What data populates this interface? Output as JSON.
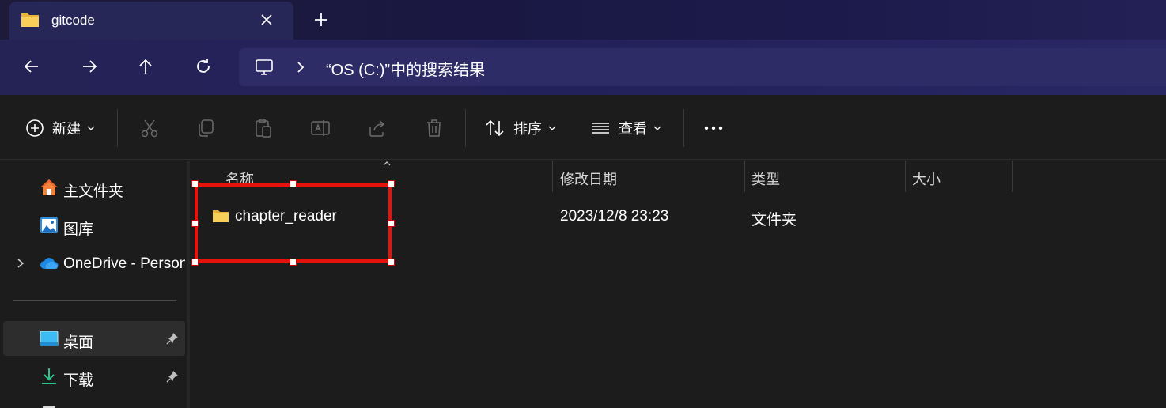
{
  "window": {
    "tab_title": "gitcode"
  },
  "address": {
    "text": "“OS (C:)”中的搜索结果"
  },
  "toolbar": {
    "new_label": "新建",
    "sort_label": "排序",
    "view_label": "查看"
  },
  "sidebar": {
    "items": [
      {
        "label": "主文件夹",
        "icon": "home-icon",
        "pinned": false,
        "selected": false
      },
      {
        "label": "图库",
        "icon": "gallery-icon",
        "pinned": false,
        "selected": false
      },
      {
        "label": "OneDrive - Personal",
        "icon": "onedrive-icon",
        "pinned": false,
        "selected": false,
        "expandable": true
      },
      {
        "label": "桌面",
        "icon": "desktop-icon",
        "pinned": true,
        "selected": true
      },
      {
        "label": "下载",
        "icon": "download-icon",
        "pinned": true,
        "selected": false
      }
    ]
  },
  "columns": {
    "name": "名称",
    "modified": "修改日期",
    "type": "类型",
    "size": "大小"
  },
  "rows": [
    {
      "name": "chapter_reader",
      "modified": "2023/12/8 23:23",
      "type": "文件夹",
      "size": ""
    }
  ],
  "colors": {
    "title_gradient_start": "#1e1b3a",
    "title_gradient_end": "#232056",
    "background": "#1c1c1c",
    "selection_annotation": "#e8120c",
    "folder_yellow": "#f4c542"
  }
}
